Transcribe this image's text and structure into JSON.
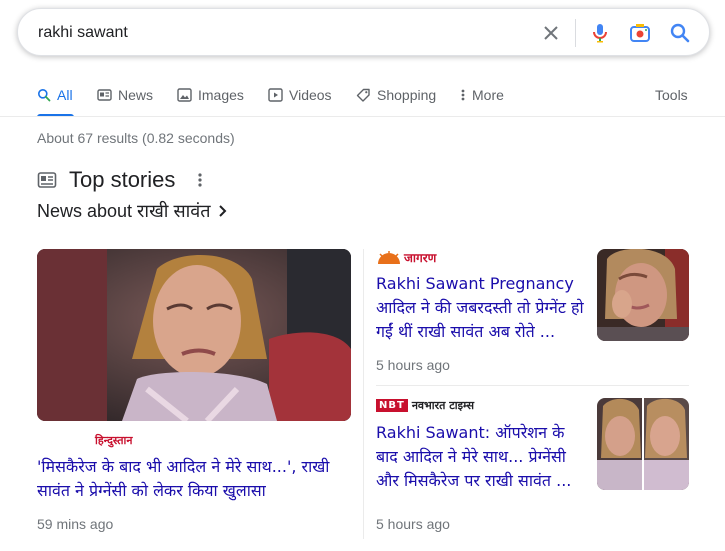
{
  "search": {
    "query": "rakhi sawant"
  },
  "tabs": [
    {
      "label": "All",
      "icon": "search-icon",
      "active": true
    },
    {
      "label": "News",
      "icon": "news-icon"
    },
    {
      "label": "Images",
      "icon": "image-icon"
    },
    {
      "label": "Videos",
      "icon": "video-icon"
    },
    {
      "label": "Shopping",
      "icon": "tag-icon"
    },
    {
      "label": "More",
      "icon": "more-vert-icon"
    }
  ],
  "tools_label": "Tools",
  "result_stats": "About 67 results (0.82 seconds)",
  "top_stories": {
    "title": "Top stories",
    "news_about": "News about राखी सावंत",
    "main_story": {
      "source": "हिन्दुस्तान",
      "headline": "'मिसकैरेज के बाद भी आदिल ने मेरे साथ...', राखी सावंत ने प्रेग्नेंसी को लेकर किया खुलासा",
      "time": "59 mins ago"
    },
    "stories": [
      {
        "source": "जागरण",
        "headline": "Rakhi Sawant Pregnancy आदिल ने की जबरदस्ती तो प्रेग्नेंट हो गईं थीं राखी सावंत अब रोते ...",
        "time": "5 hours ago"
      },
      {
        "source_badge": "NBT",
        "source": "नवभारत टाइम्स",
        "headline": "Rakhi Sawant: ऑपरेशन के बाद आदिल ने मेरे साथ... प्रेग्नेंसी और मिसकैरेज पर राखी सावंत ...",
        "time": "5 hours ago"
      }
    ]
  },
  "colors": {
    "link": "#1a0dab",
    "accent": "#1a73e8",
    "muted": "#70757a"
  }
}
